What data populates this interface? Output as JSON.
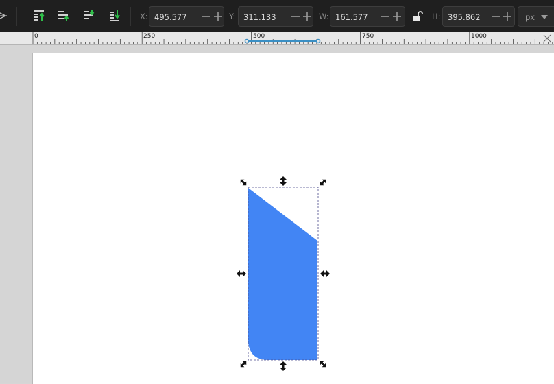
{
  "toolbar": {
    "x": {
      "label": "X:",
      "value": "495.577"
    },
    "y": {
      "label": "Y:",
      "value": "311.133"
    },
    "w": {
      "label": "W:",
      "value": "161.577"
    },
    "h": {
      "label": "H:",
      "value": "395.862"
    },
    "unit": "px",
    "lock_icon": "unlocked-padlock-icon",
    "align_icons": [
      "raise-to-top-icon",
      "raise-icon",
      "lower-icon",
      "lower-to-bottom-icon"
    ]
  },
  "ruler": {
    "labels": [
      "0",
      "250",
      "500",
      "750",
      "1000"
    ]
  },
  "colors": {
    "toolbar_bg": "#1f1f1f",
    "shape_fill": "#4285f4",
    "selection_dash": "#4a4a8a",
    "ruler_slider": "#3a8fc4"
  }
}
